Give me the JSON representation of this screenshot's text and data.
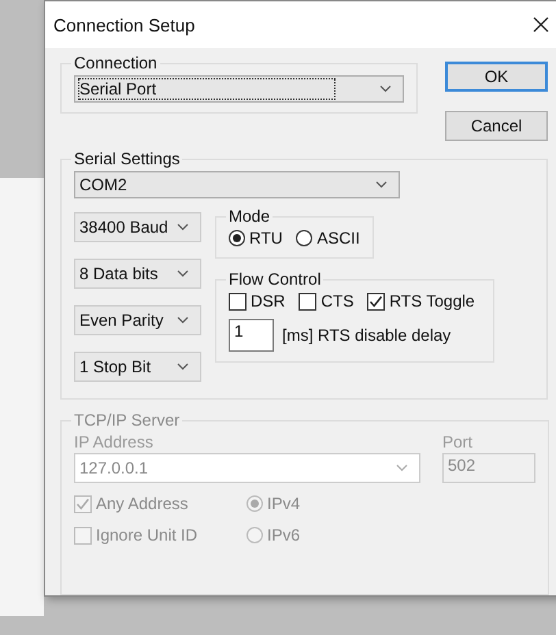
{
  "window": {
    "title": "Connection Setup"
  },
  "buttons": [
    {
      "label": "OK",
      "default": true
    },
    {
      "label": "Cancel",
      "default": false
    }
  ],
  "connection": {
    "label": "Connection",
    "value": "Serial Port"
  },
  "serial": {
    "label": "Serial Settings",
    "port": "COM2",
    "settings": [
      "38400 Baud",
      "8 Data bits",
      "Even Parity",
      "1 Stop Bit"
    ],
    "mode": {
      "label": "Mode",
      "options": [
        {
          "label": "RTU",
          "selected": true
        },
        {
          "label": "ASCII",
          "selected": false
        }
      ]
    },
    "flow_control": {
      "label": "Flow Control",
      "options": [
        {
          "label": "DSR",
          "checked": false
        },
        {
          "label": "CTS",
          "checked": false
        },
        {
          "label": "RTS Toggle",
          "checked": true
        }
      ],
      "delay_value": "1",
      "delay_label": "[ms] RTS disable delay"
    }
  },
  "tcp": {
    "label": "TCP/IP Server",
    "disabled": true,
    "ip_label": "IP Address",
    "ip_value": "127.0.0.1",
    "port_label": "Port",
    "port_value": "502",
    "checks": [
      {
        "label": "Any Address",
        "checked": true
      },
      {
        "label": "Ignore Unit ID",
        "checked": false
      }
    ],
    "ip_versions": [
      {
        "label": "IPv4",
        "selected": true
      },
      {
        "label": "IPv6",
        "selected": false
      }
    ]
  }
}
